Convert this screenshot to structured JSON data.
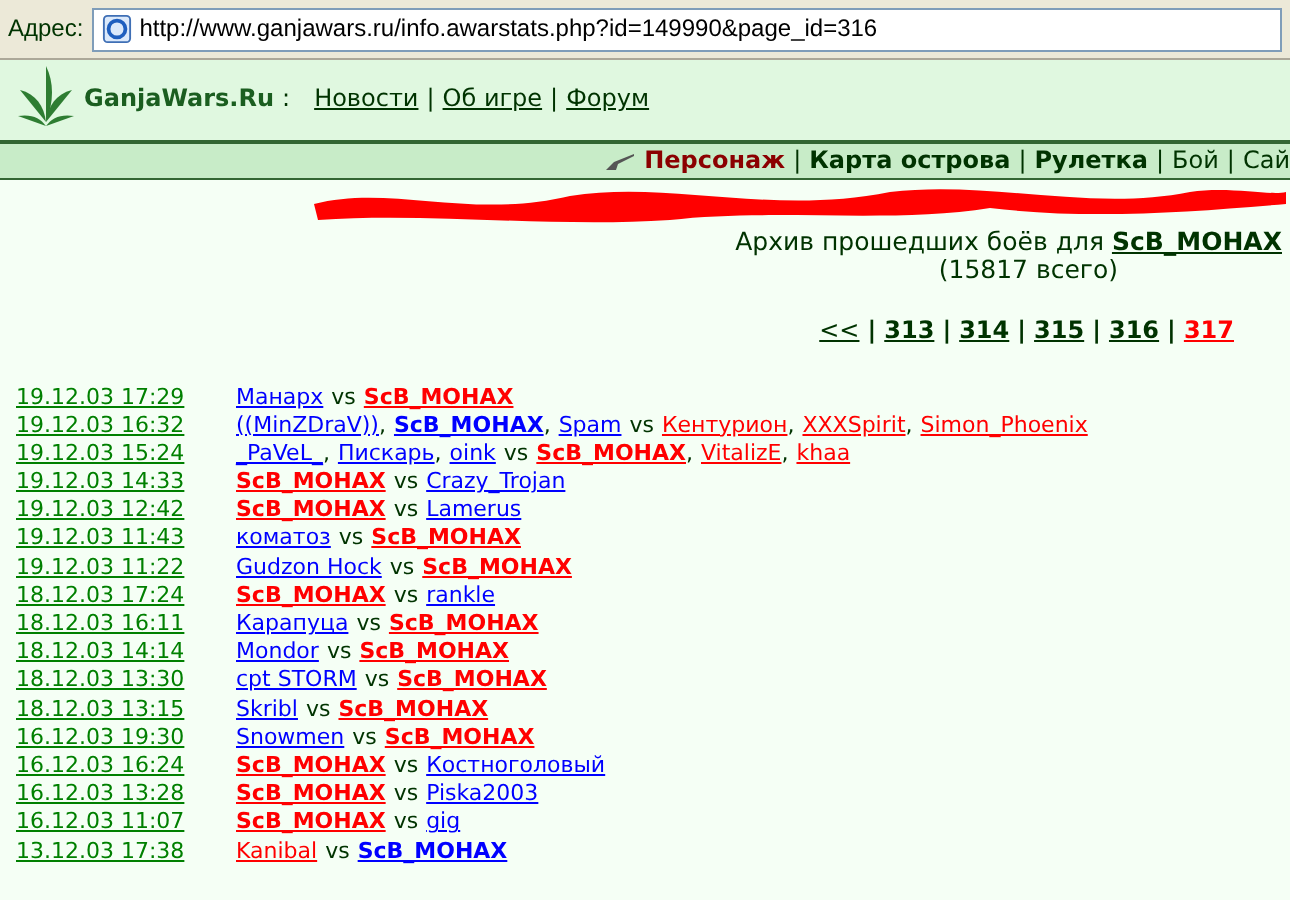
{
  "address_bar": {
    "label": "Адрес:",
    "url": "http://www.ganjawars.ru/info.awarstats.php?id=149990&page_id=316"
  },
  "header": {
    "site_name": "GanjaWars.Ru",
    "separator": ":",
    "links": [
      {
        "label": "Новости"
      },
      {
        "sep": "|",
        "label": "Об игре"
      },
      {
        "sep": "|",
        "label": "Форум"
      }
    ]
  },
  "nav": [
    {
      "label": "Персонаж",
      "selected": true,
      "bold": true
    },
    {
      "sep": "|",
      "label": "Карта острова",
      "selected": false,
      "bold": true
    },
    {
      "sep": "|",
      "label": "Рулетка",
      "selected": false,
      "bold": true
    },
    {
      "sep": "|",
      "label": "Бой",
      "selected": false,
      "bold": false
    },
    {
      "sep": "|",
      "label": "Сай",
      "selected": false,
      "bold": false
    }
  ],
  "archive": {
    "caption": "Архив прошедших боёв для",
    "player": "ScB_MOHAX",
    "total": "(15817 всего)"
  },
  "pagination": [
    {
      "label": "<<",
      "selected": false
    },
    {
      "sep": "|",
      "label": "313",
      "selected": false
    },
    {
      "sep": "|",
      "label": "314",
      "selected": false
    },
    {
      "sep": "|",
      "label": "315",
      "selected": false
    },
    {
      "sep": "|",
      "label": "316",
      "selected": false
    },
    {
      "sep": "|",
      "label": "317",
      "selected": true
    }
  ],
  "battles": [
    {
      "date": "19.12.03 17:29",
      "vs": "vs",
      "sides": [
        [
          {
            "name": "Манарх",
            "color": "#0000ff",
            "bold": false
          }
        ],
        [
          {
            "name": "ScB_MOHAX",
            "color": "#ff0000",
            "bold": true
          }
        ]
      ]
    },
    {
      "date": "19.12.03 16:32",
      "vs": "vs",
      "sides": [
        [
          {
            "name": "((MinZDraV))",
            "color": "#0000ff",
            "bold": false,
            "comma": ","
          },
          {
            "name": "ScB_MOHAX",
            "color": "#0000ff",
            "bold": true,
            "comma": ","
          },
          {
            "name": "Spam",
            "color": "#0000ff",
            "bold": false
          }
        ],
        [
          {
            "name": "Кентурион",
            "color": "#ff0000",
            "bold": false,
            "comma": ","
          },
          {
            "name": "XXXSpirit",
            "color": "#ff0000",
            "bold": false,
            "comma": ","
          },
          {
            "name": "Simon_Phoenix",
            "color": "#ff0000",
            "bold": false
          }
        ]
      ]
    },
    {
      "date": "19.12.03 15:24",
      "vs": "vs",
      "sides": [
        [
          {
            "name": "_PaVeL_",
            "color": "#0000ff",
            "bold": false,
            "comma": ","
          },
          {
            "name": "Пискарь",
            "color": "#0000ff",
            "bold": false,
            "comma": ","
          },
          {
            "name": "oink",
            "color": "#0000ff",
            "bold": false
          }
        ],
        [
          {
            "name": "ScB_MOHAX",
            "color": "#ff0000",
            "bold": true,
            "comma": ","
          },
          {
            "name": "VitalizE",
            "color": "#ff0000",
            "bold": false,
            "comma": ","
          },
          {
            "name": "khaa",
            "color": "#ff0000",
            "bold": false
          }
        ]
      ]
    },
    {
      "date": "19.12.03 14:33",
      "vs": "vs",
      "sides": [
        [
          {
            "name": "ScB_MOHAX",
            "color": "#ff0000",
            "bold": true
          }
        ],
        [
          {
            "name": "Crazy_Trojan",
            "color": "#0000ff",
            "bold": false
          }
        ]
      ]
    },
    {
      "date": "19.12.03 12:42",
      "vs": "vs",
      "sides": [
        [
          {
            "name": "ScB_MOHAX",
            "color": "#ff0000",
            "bold": true
          }
        ],
        [
          {
            "name": "Lamerus",
            "color": "#0000ff",
            "bold": false
          }
        ]
      ]
    },
    {
      "date": "19.12.03 11:43",
      "vs": "vs",
      "sides": [
        [
          {
            "name": "коматоз",
            "color": "#0000ff",
            "bold": false
          }
        ],
        [
          {
            "name": "ScB_MOHAX",
            "color": "#ff0000",
            "bold": true
          }
        ]
      ]
    },
    {
      "date": "19.12.03 11:22",
      "vs": "vs",
      "sides": [
        [
          {
            "name": "Gudzon Hock",
            "color": "#0000ff",
            "bold": false
          }
        ],
        [
          {
            "name": "ScB_MOHAX",
            "color": "#ff0000",
            "bold": true
          }
        ]
      ]
    },
    {
      "date": "18.12.03 17:24",
      "vs": "vs",
      "sides": [
        [
          {
            "name": "ScB_MOHAX",
            "color": "#ff0000",
            "bold": true
          }
        ],
        [
          {
            "name": "rankle",
            "color": "#0000ff",
            "bold": false
          }
        ]
      ]
    },
    {
      "date": "18.12.03 16:11",
      "vs": "vs",
      "sides": [
        [
          {
            "name": "Карапуца",
            "color": "#0000ff",
            "bold": false
          }
        ],
        [
          {
            "name": "ScB_MOHAX",
            "color": "#ff0000",
            "bold": true
          }
        ]
      ]
    },
    {
      "date": "18.12.03 14:14",
      "vs": "vs",
      "sides": [
        [
          {
            "name": "Mondor",
            "color": "#0000ff",
            "bold": false
          }
        ],
        [
          {
            "name": "ScB_MOHAX",
            "color": "#ff0000",
            "bold": true
          }
        ]
      ]
    },
    {
      "date": "18.12.03 13:30",
      "vs": "vs",
      "sides": [
        [
          {
            "name": "cpt STORM",
            "color": "#0000ff",
            "bold": false
          }
        ],
        [
          {
            "name": "ScB_MOHAX",
            "color": "#ff0000",
            "bold": true
          }
        ]
      ]
    },
    {
      "date": "18.12.03 13:15",
      "vs": "vs",
      "sides": [
        [
          {
            "name": "Skribl",
            "color": "#0000ff",
            "bold": false
          }
        ],
        [
          {
            "name": "ScB_MOHAX",
            "color": "#ff0000",
            "bold": true
          }
        ]
      ]
    },
    {
      "date": "16.12.03 19:30",
      "vs": "vs",
      "sides": [
        [
          {
            "name": "Snowmen",
            "color": "#0000ff",
            "bold": false
          }
        ],
        [
          {
            "name": "ScB_MOHAX",
            "color": "#ff0000",
            "bold": true
          }
        ]
      ]
    },
    {
      "date": "16.12.03 16:24",
      "vs": "vs",
      "sides": [
        [
          {
            "name": "ScB_MOHAX",
            "color": "#ff0000",
            "bold": true
          }
        ],
        [
          {
            "name": "Костноголовый",
            "color": "#0000ff",
            "bold": false
          }
        ]
      ]
    },
    {
      "date": "16.12.03 13:28",
      "vs": "vs",
      "sides": [
        [
          {
            "name": "ScB_MOHAX",
            "color": "#ff0000",
            "bold": true
          }
        ],
        [
          {
            "name": "Piska2003",
            "color": "#0000ff",
            "bold": false
          }
        ]
      ]
    },
    {
      "date": "16.12.03 11:07",
      "vs": "vs",
      "sides": [
        [
          {
            "name": "ScB_MOHAX",
            "color": "#ff0000",
            "bold": true
          }
        ],
        [
          {
            "name": "gig",
            "color": "#0000ff",
            "bold": false
          }
        ]
      ]
    },
    {
      "date": "13.12.03 17:38",
      "vs": "vs",
      "sides": [
        [
          {
            "name": "Kanibal",
            "color": "#ff0000",
            "bold": false
          }
        ],
        [
          {
            "name": "ScB_MOHAX",
            "color": "#0000ff",
            "bold": true
          }
        ]
      ]
    }
  ]
}
